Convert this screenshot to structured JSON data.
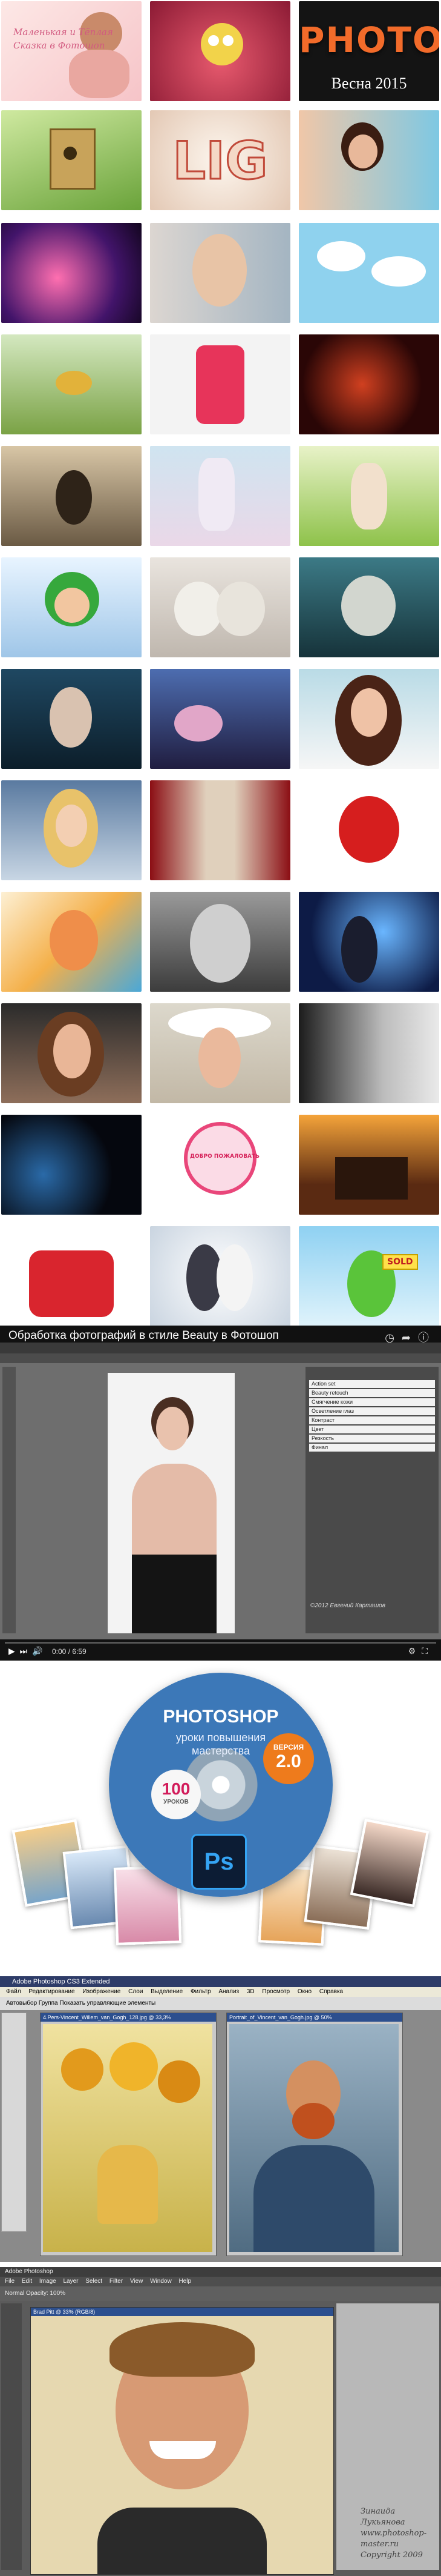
{
  "gallery": {
    "tiles": [
      {
        "caption": "Маленькая и Тёплая\nСказка в Фотошоп"
      },
      {
        "caption": ""
      },
      {
        "title_big": "PHOTO",
        "caption": "Весна 2015"
      },
      {
        "caption": ""
      },
      {
        "title_big": "LIG",
        "caption": ""
      },
      {
        "caption": ""
      },
      {
        "caption": ""
      },
      {
        "caption": ""
      },
      {
        "caption": ""
      },
      {
        "caption": ""
      },
      {
        "caption": ""
      },
      {
        "caption": ""
      },
      {
        "caption": ""
      },
      {
        "caption": ""
      },
      {
        "caption": ""
      },
      {
        "caption": ""
      },
      {
        "caption": ""
      },
      {
        "caption": ""
      },
      {
        "caption": ""
      },
      {
        "caption": ""
      },
      {
        "caption": ""
      },
      {
        "caption": ""
      },
      {
        "caption": ""
      },
      {
        "caption": ""
      },
      {
        "caption": ""
      },
      {
        "caption": ""
      },
      {
        "caption": ""
      },
      {
        "caption": ""
      },
      {
        "caption": ""
      },
      {
        "caption": ""
      },
      {
        "caption": "",
        "badge": "ДОБРО ПОЖАЛОВАТЬ"
      },
      {
        "caption": ""
      },
      {
        "caption": ""
      },
      {
        "caption": ""
      },
      {
        "caption": "",
        "badge": "SOLD"
      }
    ]
  },
  "video": {
    "title": "Обработка фотографий в стиле Beauty в Фотошоп",
    "time": "0:00 / 6:59",
    "panel_rows": [
      "Action set",
      "Beauty retouch",
      "Смягчение кожи",
      "Осветление глаз",
      "Контраст",
      "Цвет",
      "Резкость",
      "Финал"
    ],
    "watermark": "©2012 Евгений Карташов"
  },
  "promo": {
    "disc_title": "PHOTOSHOP",
    "disc_subtitle": "уроки повышения\nмастерства",
    "version_label": "ВЕРСИЯ",
    "version_number": "2.0",
    "lessons_number": "100",
    "lessons_label": "УРОКОВ",
    "ps_logo": "Ps"
  },
  "ps_sunflowers": {
    "title": "Adobe Photoshop CS3 Extended",
    "menu": "Файл Редактирование Изображение Слои Выделение Фильтр Анализ 3D Просмотр Окно Справка",
    "options": "Автовыбор  Группа  Показать управляющие элементы",
    "doc1_title": "4.Pers-Vincent_Willem_van_Gogh_128.jpg @ 33,3%",
    "doc2_title": "Portrait_of_Vincent_van_Gogh.jpg @ 50%"
  },
  "ps_portrait": {
    "title": "Adobe Photoshop",
    "menu": "File Edit Image Layer Select Filter View Window Help",
    "options": "Normal  Opacity: 100%",
    "doc_title": "Brad Pitt @ 33% (RGB/8)",
    "signature": "Зинаида Лукьянова\nwww.photoshop-master.ru\nCopyright 2009"
  }
}
